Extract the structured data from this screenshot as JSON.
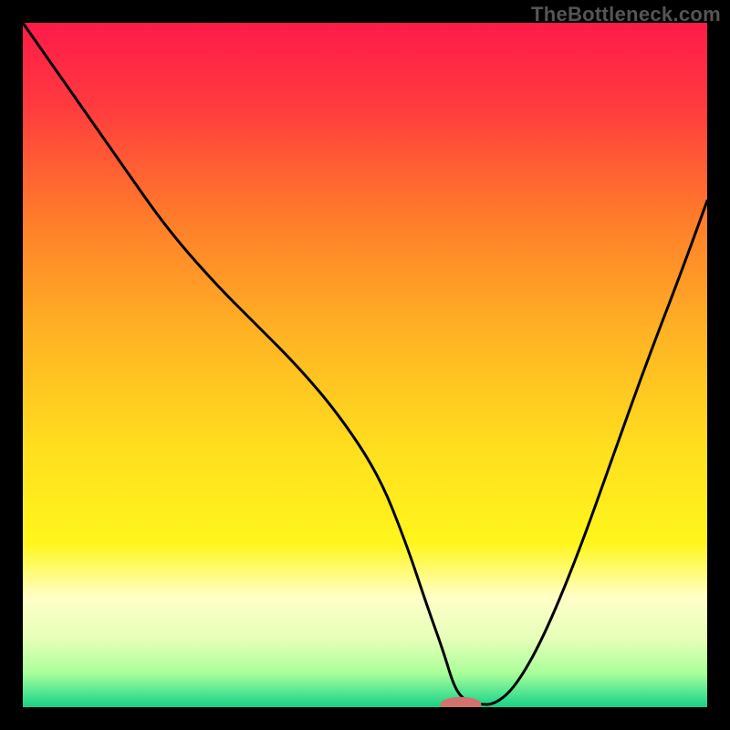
{
  "watermark": "TheBottleneck.com",
  "chart_data": {
    "type": "line",
    "title": "",
    "xlabel": "",
    "ylabel": "",
    "xlim": [
      0,
      100
    ],
    "ylim": [
      0,
      100
    ],
    "grid": false,
    "legend": false,
    "background_gradient": {
      "stops": [
        {
          "offset": 0.0,
          "color": "#ff1a4a"
        },
        {
          "offset": 0.12,
          "color": "#ff3a3f"
        },
        {
          "offset": 0.28,
          "color": "#ff7a2a"
        },
        {
          "offset": 0.45,
          "color": "#ffb224"
        },
        {
          "offset": 0.62,
          "color": "#ffde1e"
        },
        {
          "offset": 0.76,
          "color": "#fff61c"
        },
        {
          "offset": 0.84,
          "color": "#ffffc8"
        },
        {
          "offset": 0.9,
          "color": "#e6ffb8"
        },
        {
          "offset": 0.95,
          "color": "#aaff9a"
        },
        {
          "offset": 0.985,
          "color": "#40e090"
        },
        {
          "offset": 1.0,
          "color": "#18d080"
        }
      ]
    },
    "series": [
      {
        "name": "bottleneck-curve",
        "color": "#000000",
        "stroke_width": 3,
        "x": [
          0,
          7,
          14,
          21,
          28,
          34,
          40,
          46,
          52,
          56,
          59,
          61.5,
          63,
          64.5,
          66.5,
          69,
          72,
          76,
          81,
          86,
          91,
          96,
          100
        ],
        "y": [
          100,
          90,
          80,
          70,
          62,
          56,
          50,
          43,
          34,
          24,
          15,
          8,
          3,
          1,
          0.4,
          0.4,
          3,
          10,
          22,
          36,
          50,
          63,
          74
        ]
      }
    ],
    "marker": {
      "name": "optimal-marker",
      "color": "#d4706d",
      "x": 64,
      "y": 0.4,
      "rx": 3.0,
      "ry": 1.1
    }
  }
}
